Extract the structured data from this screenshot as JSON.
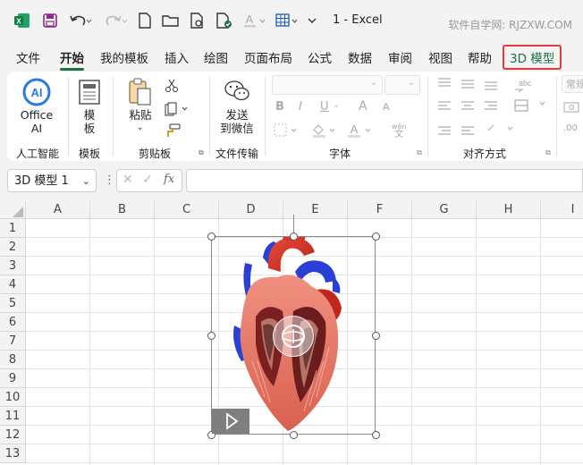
{
  "app": {
    "title": "1  -  Excel",
    "watermark": "软件自学网: RJZXW.COM"
  },
  "tabs": [
    "文件",
    "开始",
    "我的模板",
    "插入",
    "绘图",
    "页面布局",
    "公式",
    "数据",
    "审阅",
    "视图",
    "帮助",
    "3D 模型"
  ],
  "active_tab": "开始",
  "highlighted_tab": "3D 模型",
  "ribbon": {
    "groups": {
      "ai": {
        "label": "人工智能",
        "button_line1": "Office",
        "button_line2": "AI",
        "icon_text": "AI"
      },
      "template": {
        "label": "模板",
        "button_line1": "模",
        "button_line2": "板"
      },
      "clipboard": {
        "label": "剪贴板",
        "paste": "粘贴"
      },
      "transfer": {
        "label": "文件传输",
        "button_line1": "发送",
        "button_line2": "到微信"
      },
      "font": {
        "label": "字体",
        "bold": "B",
        "italic": "I",
        "underline": "U",
        "grow": "A",
        "shrink": "A",
        "wen": "wén"
      },
      "align": {
        "label": "对齐方式"
      },
      "number": {
        "label": "常规"
      }
    }
  },
  "formula_bar": {
    "name_box": "3D 模型 1",
    "fx": "fx",
    "formula": ""
  },
  "sheet": {
    "columns": [
      "A",
      "B",
      "C",
      "D",
      "E",
      "F",
      "G",
      "H",
      "I"
    ],
    "rows": [
      "1",
      "2",
      "3",
      "4",
      "5",
      "6",
      "7",
      "8",
      "9",
      "10",
      "11",
      "12",
      "13"
    ]
  },
  "model": {
    "name": "3D heart model",
    "accent": "#1e7145",
    "highlight": "#e03c3c"
  }
}
